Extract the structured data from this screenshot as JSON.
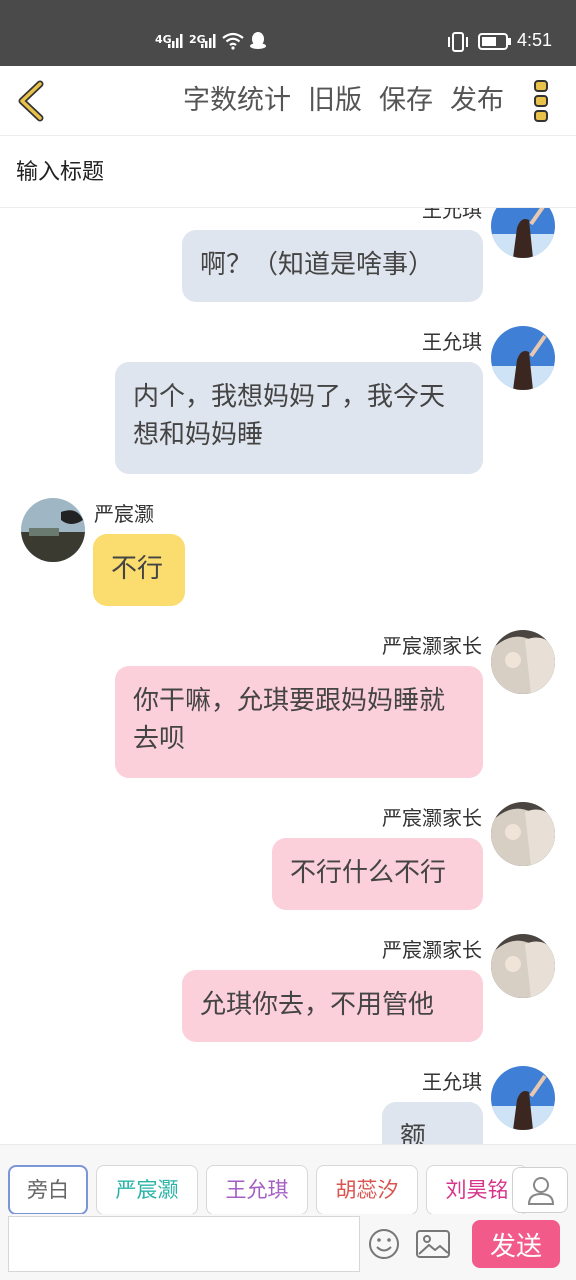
{
  "status_bar": {
    "network_1": "4G",
    "network_2": "2G",
    "time": "4:51",
    "icons": [
      "signal-icon",
      "wifi-icon",
      "qq-icon",
      "vibrate-icon",
      "battery-icon"
    ]
  },
  "header": {
    "actions": [
      "字数统计",
      "旧版",
      "保存",
      "发布"
    ],
    "accent_color": "#e8c24a"
  },
  "title_field": {
    "placeholder": "输入标题"
  },
  "messages": [
    {
      "sender": "王允琪",
      "text": "啊？（知道是啥事）",
      "side": "right",
      "color": "#dfe5ee"
    },
    {
      "sender": "王允琪",
      "text": "内个，我想妈妈了，我今天想和妈妈睡",
      "side": "right",
      "color": "#dfe5ee"
    },
    {
      "sender": "严宸灏",
      "text": "不行",
      "side": "left",
      "color": "#fbdc6e"
    },
    {
      "sender": "严宸灏家长",
      "text": "你干嘛，允琪要跟妈妈睡就去呗",
      "side": "right",
      "color": "#fbd0db"
    },
    {
      "sender": "严宸灏家长",
      "text": "不行什么不行",
      "side": "right",
      "color": "#fbd0db"
    },
    {
      "sender": "严宸灏家长",
      "text": "允琪你去，不用管他",
      "side": "right",
      "color": "#fbd0db"
    },
    {
      "sender": "王允琪",
      "text": "额",
      "side": "right",
      "color": "#dfe5ee"
    }
  ],
  "roles": [
    {
      "label": "旁白",
      "color": "#666666"
    },
    {
      "label": "严宸灏",
      "color": "#2bb3a8"
    },
    {
      "label": "王允琪",
      "color": "#a45fc4"
    },
    {
      "label": "胡蕊汐",
      "color": "#d9534f"
    },
    {
      "label": "刘昊铭",
      "color": "#d6338a"
    }
  ],
  "composer": {
    "placeholder": "",
    "send_label": "发送",
    "send_color": "#f25a8a"
  }
}
